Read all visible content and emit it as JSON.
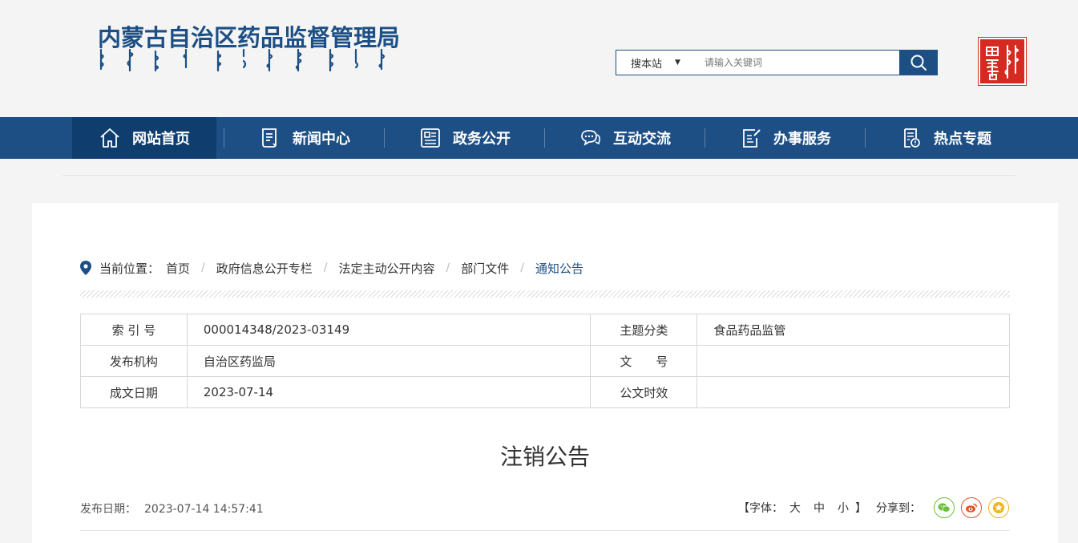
{
  "header": {
    "title": "内蒙古自治区药品监督管理局",
    "search": {
      "scope": "搜本站",
      "placeholder": "请输入关键词"
    }
  },
  "nav": [
    {
      "label": "网站首页",
      "icon": "home-icon",
      "active": true
    },
    {
      "label": "新闻中心",
      "icon": "news-icon",
      "active": false
    },
    {
      "label": "政务公开",
      "icon": "document-list-icon",
      "active": false
    },
    {
      "label": "互动交流",
      "icon": "chat-icon",
      "active": false
    },
    {
      "label": "办事服务",
      "icon": "edit-form-icon",
      "active": false
    },
    {
      "label": "热点专题",
      "icon": "topic-icon",
      "active": false
    }
  ],
  "breadcrumb": {
    "label": "当前位置：",
    "items": [
      "首页",
      "政府信息公开专栏",
      "法定主动公开内容",
      "部门文件",
      "通知公告"
    ]
  },
  "meta_table": [
    {
      "k1": "索 引 号",
      "v1": "000014348/2023-03149",
      "k2": "主题分类",
      "v2": "食品药品监管"
    },
    {
      "k1": "发布机构",
      "v1": "自治区药监局",
      "k2": "文　　号",
      "v2": ""
    },
    {
      "k1": "成文日期",
      "v1": "2023-07-14",
      "k2": "公文时效",
      "v2": ""
    }
  ],
  "article": {
    "title": "注销公告",
    "pub_label": "发布日期：",
    "pub_date": "2023-07-14 14:57:41"
  },
  "tools": {
    "font_open": "【字体：",
    "font_large": "大",
    "font_medium": "中",
    "font_small": "小",
    "font_close": "】",
    "share_label": "分享到：",
    "share_icons": [
      "wechat-icon",
      "weibo-icon",
      "favorite-icon"
    ]
  },
  "colors": {
    "brand": "#1d4f85",
    "nav_active": "#0f3e6e",
    "seal": "#d42a22",
    "wechat": "#6cbf3c",
    "weibo": "#e6512b",
    "favorite": "#f0b323"
  }
}
